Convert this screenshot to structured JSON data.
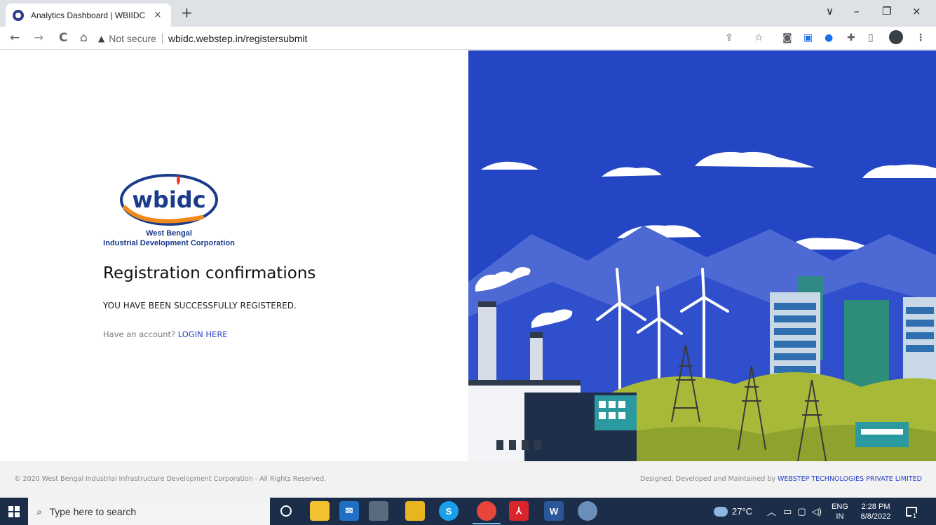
{
  "browser": {
    "tab_title": "Analytics Dashboard | WBIIDC",
    "tab_close": "×",
    "new_tab": "+",
    "window_controls": {
      "dropdown": "∨",
      "minimize": "–",
      "restore": "❐",
      "close": "×"
    },
    "nav": {
      "back": "←",
      "forward": "→",
      "reload": "C",
      "home": "⌂"
    },
    "security_icon": "warning-triangle-icon",
    "security_label": "Not secure",
    "url": "wbidc.webstep.in/registersubmit",
    "toolbar_icons": [
      "share-icon",
      "star-icon",
      "camera-icon",
      "screen-capture-icon",
      "extension-blue-icon",
      "puzzle-icon",
      "sidepanel-icon",
      "profile-avatar",
      "menu-icon"
    ]
  },
  "logo": {
    "wordmark": "wbidc",
    "line1": "West Bengal",
    "line2": "Industrial Development Corporation",
    "colors": {
      "navy": "#1a3a8a",
      "orange": "#f08a1c",
      "red": "#e53a1e"
    }
  },
  "main": {
    "heading": "Registration confirmations",
    "message": "YOU HAVE BEEN SUCCESSFULLY REGISTERED.",
    "account_prompt": "Have an account?",
    "login_link": "LOGIN HERE"
  },
  "footer": {
    "copyright": "© 2020 West Bengal Industrial Infrastructure Development Corporation - All Rights Reserved.",
    "credit_prefix": "Designed, Developed and Maintained by",
    "credit_link": "WEBSTEP TECHNOLOGIES PRIVATE LIMITED"
  },
  "illustration": {
    "subject": "industrial-landscape",
    "sky_color": "#2546c4",
    "mountain_color": "#4d6ad4",
    "hill_color": "#a8b93a"
  },
  "taskbar": {
    "search_placeholder": "Type here to search",
    "apps": [
      "cortana-icon",
      "file-explorer-icon",
      "mail-icon",
      "network-icon",
      "lock-app-icon",
      "skype-icon",
      "chrome-icon",
      "acrobat-icon",
      "word-icon",
      "paint-icon"
    ],
    "weather": "27°C",
    "language": "ENG",
    "region": "IN",
    "time": "2:28 PM",
    "date": "8/8/2022",
    "notification_count": "1"
  }
}
